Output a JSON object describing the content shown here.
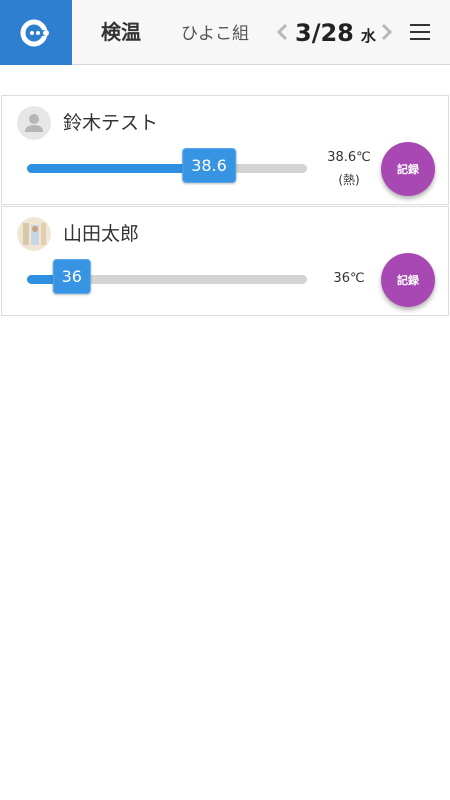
{
  "header": {
    "page_title": "検温",
    "class_name": "ひよこ組",
    "date": "3/28",
    "weekday": "水"
  },
  "children": [
    {
      "name": "鈴木テスト",
      "slider_value": "38.6",
      "slider_fraction": 0.65,
      "temperature": "38.6℃",
      "note": "(熱)",
      "record_label": "記録"
    },
    {
      "name": "山田太郎",
      "slider_value": "36",
      "slider_fraction": 0.16,
      "temperature": "36℃",
      "record_label": "記録"
    }
  ],
  "colors": {
    "brand": "#2f7fd1",
    "slider": "#3794e3",
    "record": "#a848b2"
  }
}
